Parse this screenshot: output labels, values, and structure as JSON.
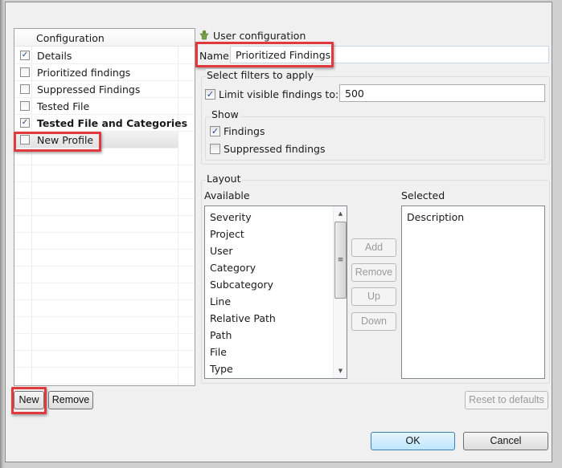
{
  "profiles_table": {
    "header": "Configuration",
    "rows": [
      {
        "label": "Details",
        "checked": true,
        "bold": false
      },
      {
        "label": "Prioritized findings",
        "checked": false,
        "bold": false
      },
      {
        "label": "Suppressed Findings",
        "checked": false,
        "bold": false
      },
      {
        "label": "Tested File",
        "checked": false,
        "bold": false
      },
      {
        "label": "Tested File and Categories",
        "checked": true,
        "bold": true
      },
      {
        "label": "New Profile",
        "checked": false,
        "bold": false,
        "selected": true
      }
    ],
    "new_button": "New",
    "remove_button": "Remove"
  },
  "user_config": {
    "icon": "user-icon",
    "title": "User configuration",
    "name_label": "Name",
    "name_value": "Prioritized Findings"
  },
  "filters": {
    "title": "Select filters to apply",
    "limit_label": "Limit visible findings to:",
    "limit_checked": true,
    "limit_value": "500",
    "show_title": "Show",
    "findings_label": "Findings",
    "findings_checked": true,
    "suppressed_label": "Suppressed findings",
    "suppressed_checked": false
  },
  "layout": {
    "title": "Layout",
    "available_label": "Available",
    "selected_label": "Selected",
    "available_items": [
      "Severity",
      "Project",
      "User",
      "Category",
      "Subcategory",
      "Line",
      "Relative Path",
      "Path",
      "File",
      "Type"
    ],
    "selected_items": [
      "Description"
    ],
    "add_button": "Add",
    "remove_button": "Remove",
    "up_button": "Up",
    "down_button": "Down"
  },
  "footer": {
    "reset_button": "Reset to defaults",
    "ok_button": "OK",
    "cancel_button": "Cancel"
  },
  "colors": {
    "highlight": "#e03a3e",
    "dialog_bg": "#f0f0f0",
    "default_button": "#bee6fd"
  }
}
